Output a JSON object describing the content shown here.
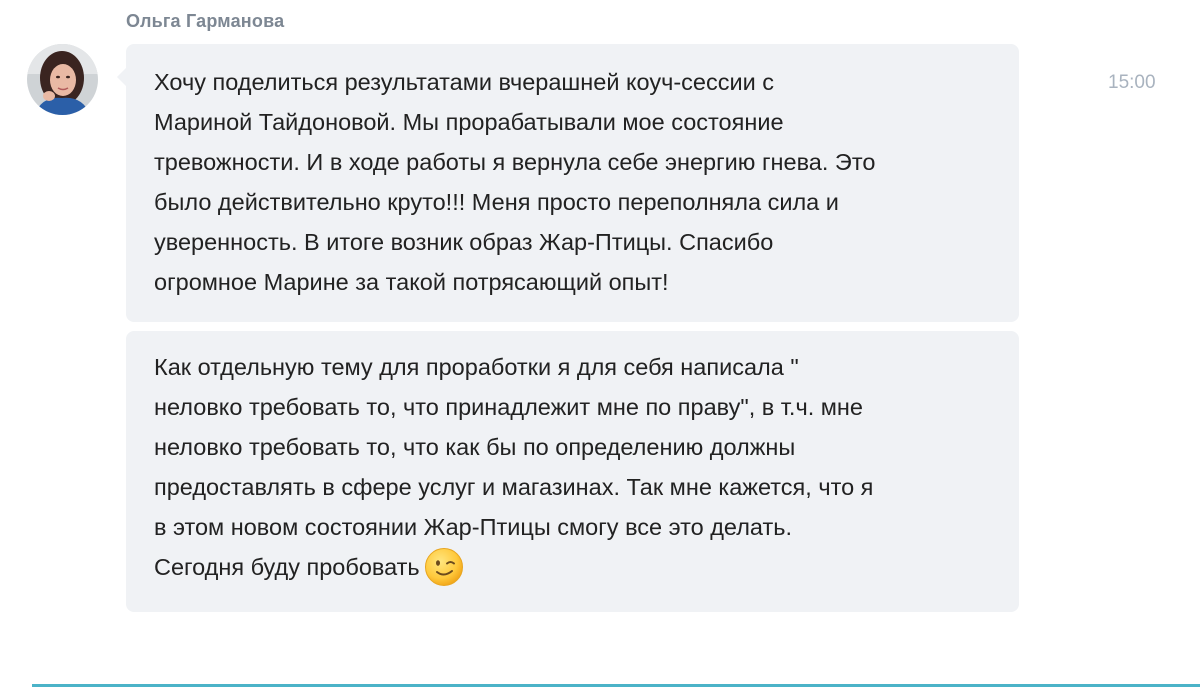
{
  "message": {
    "sender_name": "Ольга Гарманова",
    "time": "15:00",
    "bubble_1_lines": [
      "Хочу поделиться результатами вчерашней коуч-сессии с",
      "Мариной Тайдоновой. Мы прорабатывали мое состояние",
      "тревожности. И в ходе работы я вернула себе энергию гнева. Это",
      "было действительно круто!!! Меня просто переполняла сила и",
      "уверенность. В итоге возник образ Жар-Птицы. Спасибо",
      "огромное Марине за такой потрясающий опыт!"
    ],
    "bubble_2_lines": [
      "Как отдельную тему для проработки я для себя написала \"",
      "неловко требовать то, что принадлежит мне по праву\", в т.ч. мне",
      "неловко требовать то, что как бы по определению должны",
      "предоставлять в сфере услуг и магазинах. Так мне кажется, что я",
      "в этом новом состоянии Жар-Птицы смогу все это делать.",
      "Сегодня буду пробовать"
    ],
    "emoji": "wink-emoji-icon"
  },
  "colors": {
    "sender_name": "#7d8793",
    "bubble_bg": "#f0f2f5",
    "time": "#a9b3bf",
    "text": "#222222",
    "bottom_line": "#4bb3c8"
  }
}
